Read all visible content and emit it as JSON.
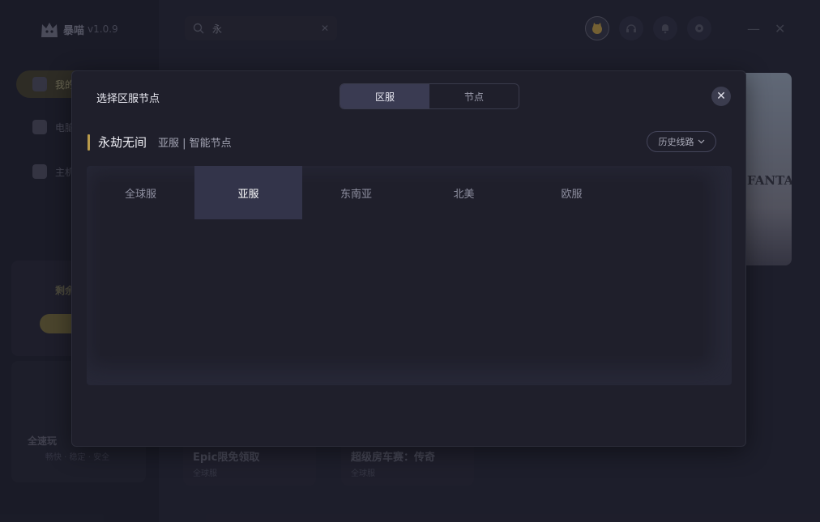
{
  "app": {
    "name": "暴喵",
    "version": "v1.0.9"
  },
  "search": {
    "value": "永",
    "clear_icon": "close-icon"
  },
  "sidebar": {
    "items": [
      {
        "label": "我的",
        "icon": "gamepad-icon",
        "active": true
      },
      {
        "label": "电脑",
        "icon": "monitor-icon"
      },
      {
        "label": "主机",
        "icon": "console-icon"
      }
    ],
    "promo_title": "剩余",
    "card_title": "全速玩",
    "card_sub": "畅快 · 稳定 · 安全"
  },
  "background": {
    "banner_text": "FANTASY",
    "tiles": [
      {
        "name": "Epic限免领取",
        "sub": "全球服"
      },
      {
        "name": "超级房车赛：传奇",
        "sub": "全球服"
      }
    ]
  },
  "modal": {
    "title": "选择区服节点",
    "segments": [
      {
        "label": "区服",
        "active": true
      },
      {
        "label": "节点",
        "active": false
      }
    ],
    "close_icon": "close-icon",
    "game_name": "永劫无间",
    "game_sub": "亚服 | 智能节点",
    "history_label": "历史线路",
    "accent_color": "#b89a4b",
    "region_tabs": [
      {
        "label": "全球服",
        "active": false
      },
      {
        "label": "亚服",
        "active": true
      },
      {
        "label": "东南亚",
        "active": false
      },
      {
        "label": "北美",
        "active": false
      },
      {
        "label": "欧服",
        "active": false
      }
    ]
  }
}
